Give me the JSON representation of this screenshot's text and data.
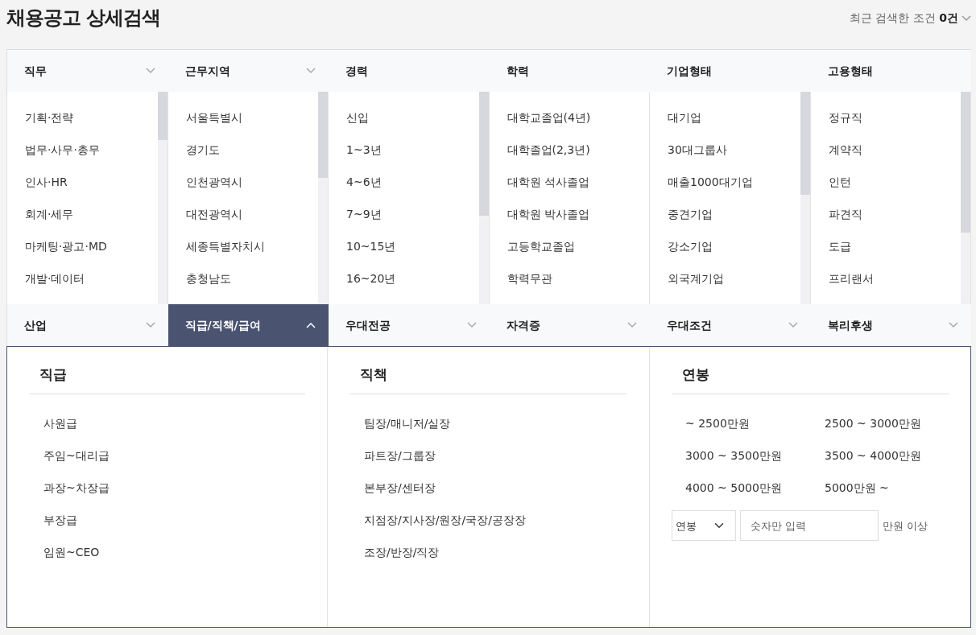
{
  "title": "채용공고 상세검색",
  "recent": {
    "label": "최근 검색한 조건 **0건**",
    "expanded": false
  },
  "filters": [
    {
      "label": "직무",
      "expanded": false,
      "scrollable": true,
      "options": [
        "기획·전략",
        "법무·사무·총무",
        "인사·HR",
        "회계·세무",
        "마케팅·광고·MD",
        "개발·데이터"
      ]
    },
    {
      "label": "근무지역",
      "expanded": false,
      "scrollable": true,
      "options": [
        "서울특별시",
        "경기도",
        "인천광역시",
        "대전광역시",
        "세종특별자치시",
        "충청남도"
      ]
    },
    {
      "label": "경력",
      "scrollable": true,
      "options": [
        "신입",
        "1~3년",
        "4~6년",
        "7~9년",
        "10~15년",
        "16~20년"
      ]
    },
    {
      "label": "학력",
      "scrollable": false,
      "options": [
        "대학교졸업(4년)",
        "대학졸업(2,3년)",
        "대학원 석사졸업",
        "대학원 박사졸업",
        "고등학교졸업",
        "학력무관"
      ]
    },
    {
      "label": "기업형태",
      "scrollable": true,
      "options": [
        "대기업",
        "30대그룹사",
        "매출1000대기업",
        "중견기업",
        "강소기업",
        "외국계기업"
      ]
    },
    {
      "label": "고용형태",
      "scrollable": true,
      "options": [
        "정규직",
        "계약직",
        "인턴",
        "파견직",
        "도급",
        "프리랜서"
      ]
    }
  ],
  "more_filters": [
    {
      "label": "산업",
      "expanded": false
    },
    {
      "label": "직급/직책/급여",
      "expanded": true
    },
    {
      "label": "우대전공",
      "expanded": false
    },
    {
      "label": "자격증",
      "expanded": false
    },
    {
      "label": "우대조건",
      "expanded": false
    },
    {
      "label": "복리후생",
      "expanded": false
    }
  ],
  "panel": {
    "sections": [
      {
        "kind": "list",
        "title": "직급",
        "options": [
          "사원급",
          "주임~대리급",
          "과장~차장급",
          "부장급",
          "임원~CEO"
        ]
      },
      {
        "kind": "list",
        "title": "직책",
        "options": [
          "팀장/매니저/실장",
          "파트장/그룹장",
          "본부장/센터장",
          "지점장/지사장/원장/국장/공장장",
          "조장/반장/직장"
        ]
      },
      {
        "kind": "salary",
        "title": "연봉",
        "options": [
          "~ 2500만원",
          "2500 ~ 3000만원",
          "3000 ~ 3500만원",
          "3500 ~ 4000만원",
          "4000 ~ 5000만원",
          "5000만원 ~"
        ],
        "select": "연봉",
        "input_placeholder": "숫자만 입력",
        "suffix": "만원 이상"
      }
    ]
  }
}
